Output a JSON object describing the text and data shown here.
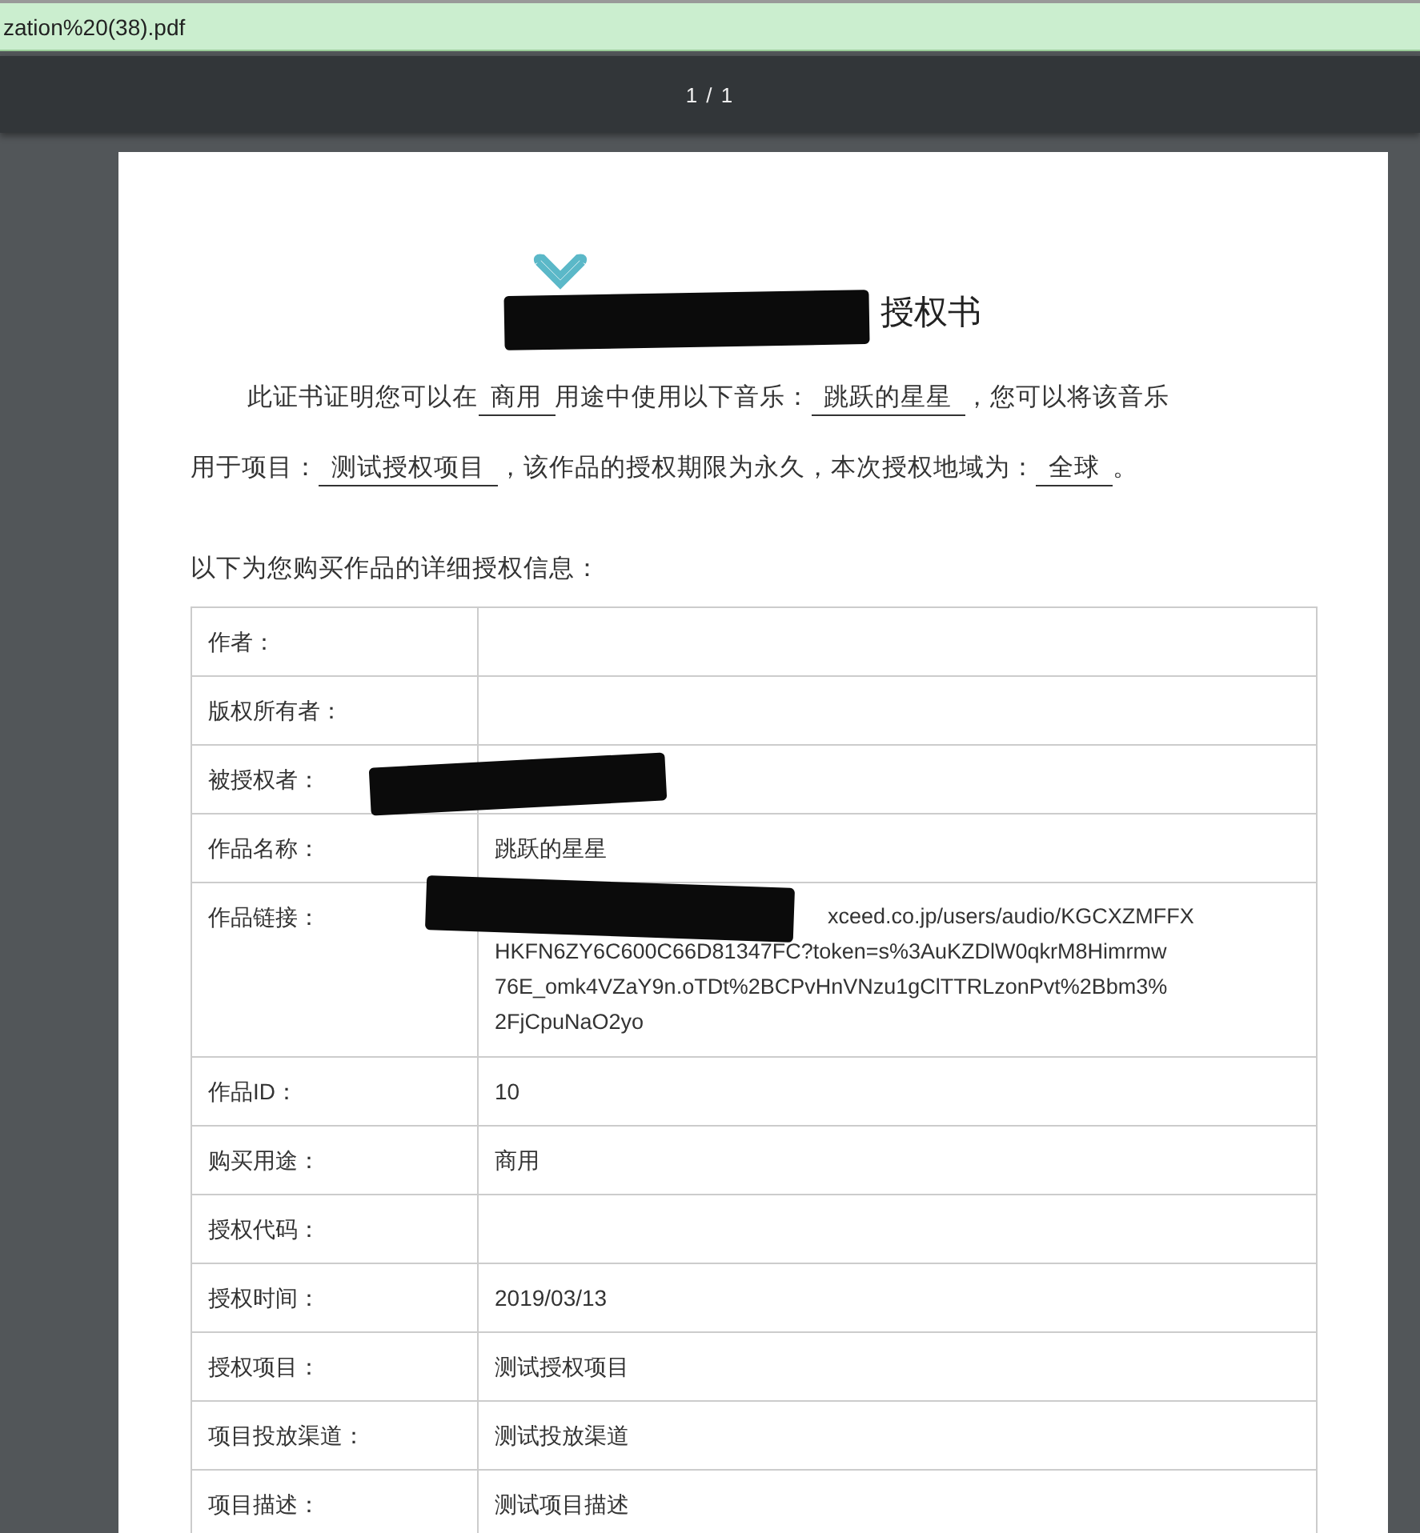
{
  "tab": {
    "title": "zation%20(38).pdf"
  },
  "toolbar": {
    "page_indicator": "1 / 1"
  },
  "document": {
    "title": "授权书",
    "paragraph": [
      [
        {
          "kind": "text",
          "text": "此证书证明您可以在"
        },
        {
          "kind": "fill",
          "text": "商用"
        },
        {
          "kind": "text",
          "text": "用途中使用以下音乐："
        },
        {
          "kind": "fill",
          "text": "跳跃的星星"
        },
        {
          "kind": "text",
          "text": "，您可以将该音乐"
        }
      ],
      [
        {
          "kind": "text",
          "text": "用于项目："
        },
        {
          "kind": "fill",
          "text": "测试授权项目"
        },
        {
          "kind": "text",
          "text": "，该作品的授权期限为永久，本次授权地域为："
        },
        {
          "kind": "fill",
          "text": "全球"
        },
        {
          "kind": "text",
          "text": "。"
        }
      ]
    ],
    "table_caption": "以下为您购买作品的详细授权信息：",
    "rows": [
      {
        "label": "作者：",
        "value": ""
      },
      {
        "label": "版权所有者：",
        "value": ""
      },
      {
        "label": "被授权者：",
        "value": ""
      },
      {
        "label": "作品名称：",
        "value": "跳跃的星星"
      },
      {
        "label": "作品链接：",
        "value_lines": [
          "xceed.co.jp/users/audio/KGCXZMFFX",
          "HKFN6ZY6C600C66D81347FC?token=s%3AuKZDlW0qkrM8Himrmw",
          "76E_omk4VZaY9n.oTDt%2BCPvHnVNzu1gClTTRLzonPvt%2Bbm3%",
          "2FjCpuNaO2yo"
        ]
      },
      {
        "label": "作品ID：",
        "value": "10"
      },
      {
        "label": "购买用途：",
        "value": "商用"
      },
      {
        "label": "授权代码：",
        "value": ""
      },
      {
        "label": "授权时间：",
        "value": "2019/03/13"
      },
      {
        "label": "授权项目：",
        "value": "测试授权项目"
      },
      {
        "label": "项目投放渠道：",
        "value": "测试投放渠道"
      },
      {
        "label": "项目描述：",
        "value": "测试项目描述"
      }
    ]
  }
}
